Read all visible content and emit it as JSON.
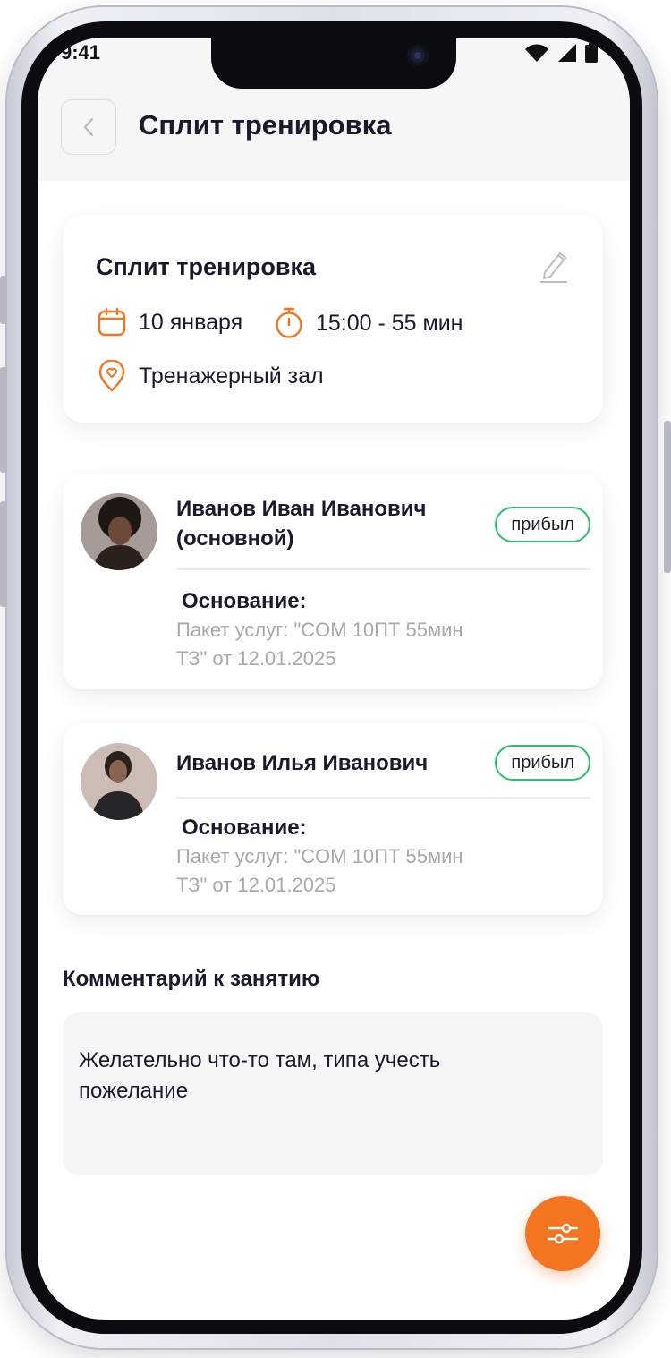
{
  "status_bar": {
    "time": "9:41"
  },
  "header": {
    "title": "Сплит тренировка"
  },
  "session": {
    "title": "Сплит тренировка",
    "date": "10 января",
    "time": "15:00 - 55 мин",
    "location": "Тренажерный зал"
  },
  "participants": [
    {
      "name_line1": "Иванов Иван Иванович",
      "name_line2": "(основной)",
      "status": "прибыл",
      "basis_label": "Основание:",
      "basis_line1": "Пакет услуг: \"COM 10ПТ 55мин",
      "basis_line2": "ТЗ\" от 12.01.2025"
    },
    {
      "name_line1": "Иванов Илья Иванович",
      "status": "прибыл",
      "basis_label": "Основание:",
      "basis_line1": "Пакет услуг: \"COM 10ПТ 55мин",
      "basis_line2": "ТЗ\" от 12.01.2025"
    }
  ],
  "comment": {
    "title": "Комментарий к занятию",
    "line1": "Желательно что-то там, типа учесть",
    "line2": "пожелание"
  },
  "colors": {
    "accent": "#f37421",
    "status_ok": "#27c267",
    "text": "#191a2c",
    "muted": "#a8a8b0"
  },
  "icons": {
    "back": "chevron-left-icon",
    "edit": "pencil-icon",
    "date": "calendar-icon",
    "time": "stopwatch-icon",
    "location": "map-pin-heart-icon",
    "fab": "sliders-icon"
  }
}
